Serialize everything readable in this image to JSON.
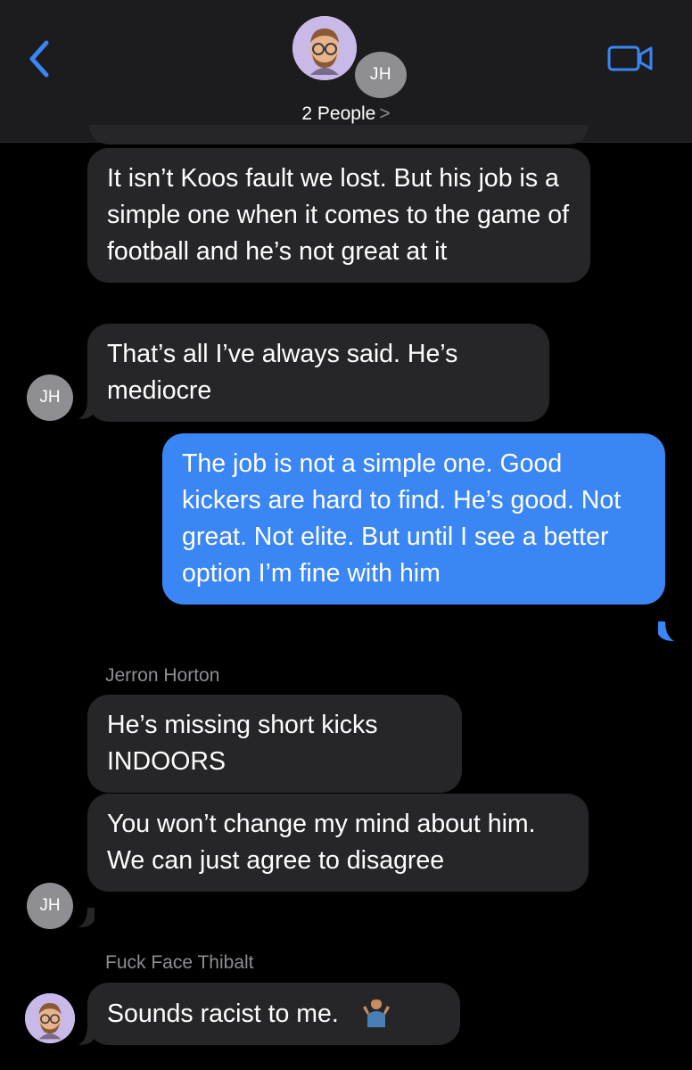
{
  "header": {
    "back_icon": "chevron-left-icon",
    "video_icon": "video-call-icon",
    "group_label": "2 People",
    "group_chevron": ">",
    "initials": "JH",
    "colors": {
      "header_bg": "#1c1c1e",
      "accent": "#3a86f5"
    }
  },
  "messages": [
    {
      "direction": "incoming",
      "text": "It isn’t Koos fault we lost. But his job is a simple one when it comes to the game of football and he’s not great at it"
    },
    {
      "direction": "incoming",
      "text": "That’s all I’ve always said. He’s mediocre",
      "avatar": "JH"
    },
    {
      "direction": "outgoing",
      "text": "The job is not a simple one. Good kickers are hard to find. He’s good. Not great. Not elite. But until I see a better option I’m fine with him"
    },
    {
      "sender": "Jerron Horton",
      "direction": "incoming",
      "text": "He’s missing short kicks INDOORS"
    },
    {
      "direction": "incoming",
      "text": "You won’t change my mind about him. We can just agree to disagree",
      "avatar": "JH"
    },
    {
      "sender": "Fuck Face Thibalt",
      "direction": "incoming",
      "text": "Sounds racist to me.",
      "emoji": "person-shrugging-emoji",
      "avatar": "memoji"
    }
  ]
}
